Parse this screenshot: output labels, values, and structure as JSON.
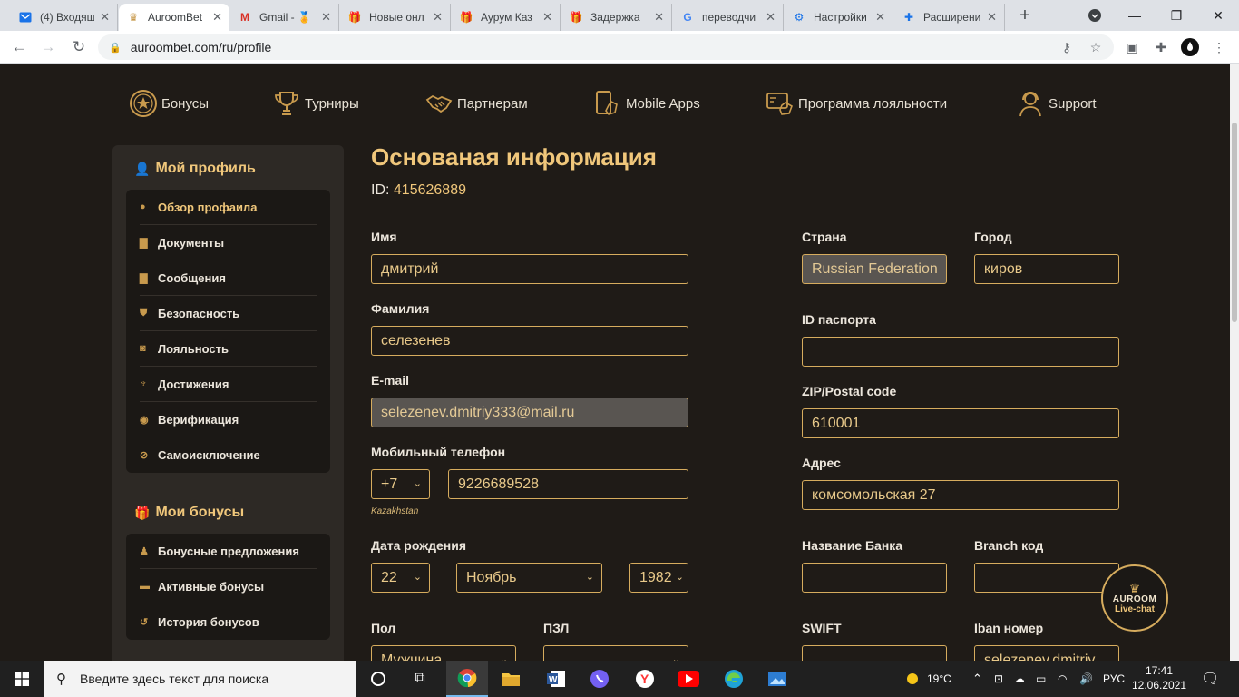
{
  "browser": {
    "tabs": [
      {
        "title": "(4) Входящи",
        "icon": "mail-icon"
      },
      {
        "title": "AuroomBet",
        "icon": "crown-icon"
      },
      {
        "title": "Gmail - 🏅",
        "icon": "gmail-icon"
      },
      {
        "title": "Новые онл",
        "icon": "gift-icon"
      },
      {
        "title": "Аурум Каз",
        "icon": "gift-icon"
      },
      {
        "title": "Задержка",
        "icon": "gift-icon"
      },
      {
        "title": "переводчи",
        "icon": "google-icon"
      },
      {
        "title": "Настройки",
        "icon": "gear-icon"
      },
      {
        "title": "Расширени",
        "icon": "puzzle-icon"
      }
    ],
    "url": "auroombet.com/ru/profile"
  },
  "topnav": [
    {
      "label": "Бонусы",
      "icon": "bonus-star-icon"
    },
    {
      "label": "Турниры",
      "icon": "trophy-icon"
    },
    {
      "label": "Партнерам",
      "icon": "handshake-icon"
    },
    {
      "label": "Mobile Apps",
      "icon": "mobile-icon"
    },
    {
      "label": "Программа лояльности",
      "icon": "loyalty-card-icon"
    },
    {
      "label": "Support",
      "icon": "support-headset-icon"
    }
  ],
  "sidebar": {
    "profile_title": "Мой профиль",
    "profile_items": [
      {
        "label": "Обзор профаила",
        "icon": "user-icon"
      },
      {
        "label": "Документы",
        "icon": "document-icon"
      },
      {
        "label": "Сообщения",
        "icon": "message-icon"
      },
      {
        "label": "Безопасность",
        "icon": "shield-icon"
      },
      {
        "label": "Лояльность",
        "icon": "loyalty-icon"
      },
      {
        "label": "Достижения",
        "icon": "trophy-icon"
      },
      {
        "label": "Верификация",
        "icon": "verification-icon"
      },
      {
        "label": "Самоисключение",
        "icon": "block-icon"
      }
    ],
    "bonuses_title": "Мои бонусы",
    "bonus_items": [
      {
        "label": "Бонусные предложения",
        "icon": "money-bag-icon"
      },
      {
        "label": "Активные бонусы",
        "icon": "cash-icon"
      },
      {
        "label": "История бонусов",
        "icon": "history-icon"
      }
    ]
  },
  "main": {
    "title": "Основаная информация",
    "id_label": "ID:",
    "id_value": "415626889",
    "fields": {
      "first_name": {
        "label": "Имя",
        "value": "дмитрий"
      },
      "last_name": {
        "label": "Фамилия",
        "value": "селезенев"
      },
      "email": {
        "label": "E-mail",
        "value": "selezenev.dmitriy333@mail.ru"
      },
      "phone": {
        "label": "Мобильный телефон",
        "code": "+7",
        "value": "9226689528",
        "hint": "Kazakhstan"
      },
      "birth": {
        "label": "Дата рождения",
        "day": "22",
        "month": "Ноябрь",
        "year": "1982"
      },
      "gender": {
        "label": "Пол",
        "value": "Мужчина"
      },
      "pzl": {
        "label": "ПЗЛ",
        "value": ""
      },
      "country": {
        "label": "Страна",
        "value": "Russian Federation"
      },
      "city": {
        "label": "Город",
        "value": "киров"
      },
      "passport": {
        "label": "ID паспорта",
        "value": ""
      },
      "zip": {
        "label": "ZIP/Postal code",
        "value": "610001"
      },
      "address": {
        "label": "Адрес",
        "value": "комсомольская 27"
      },
      "bank": {
        "label": "Название Банка",
        "value": ""
      },
      "branch": {
        "label": "Branch код",
        "value": ""
      },
      "swift": {
        "label": "SWIFT",
        "value": ""
      },
      "iban": {
        "label": "Iban номер",
        "value": "selezenev.dmitriy"
      }
    }
  },
  "livechat": {
    "line1": "AUROOM",
    "line2": "Live-chat"
  },
  "taskbar": {
    "search_placeholder": "Введите здесь текст для поиска",
    "weather": "19°C",
    "lang": "РУС",
    "time": "17:41",
    "date": "12.06.2021"
  },
  "colors": {
    "accent": "#f0c77b",
    "border": "#d6ac5e",
    "bg": "#1f1b17"
  }
}
